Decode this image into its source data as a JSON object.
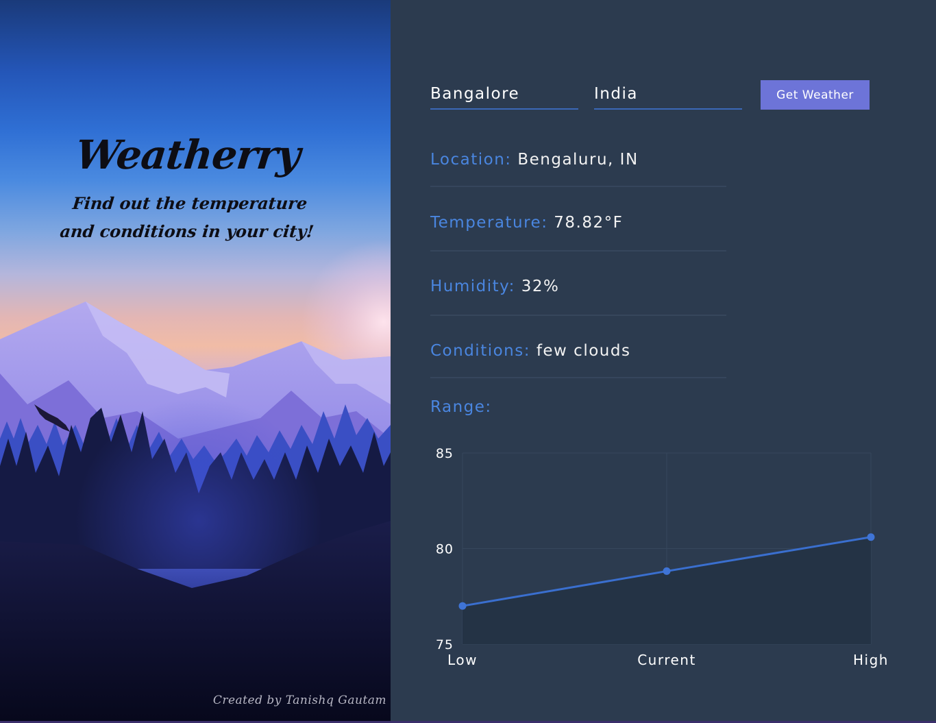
{
  "hero": {
    "title": "Weatherry",
    "subtitle_line1": "Find out the temperature",
    "subtitle_line2": "and conditions in your city!",
    "credit": "Created by Tanishq Gautam"
  },
  "form": {
    "city_value": "Bangalore",
    "country_value": "India",
    "submit_label": "Get Weather"
  },
  "info": {
    "location_label": "Location:",
    "location_value": "Bengaluru, IN",
    "temperature_label": "Temperature:",
    "temperature_value": "78.82°F",
    "humidity_label": "Humidity:",
    "humidity_value": "32%",
    "conditions_label": "Conditions:",
    "conditions_value": "few clouds",
    "range_label": "Range:"
  },
  "colors": {
    "accent": "#4a86e0",
    "button": "#6d74d8",
    "panel_bg": "#2c3b4f",
    "line": "#3a6fcf"
  },
  "chart_data": {
    "type": "line",
    "categories": [
      "Low",
      "Current",
      "High"
    ],
    "series": [
      {
        "values": [
          77.0,
          78.82,
          80.6
        ]
      }
    ],
    "ylim": [
      75,
      85
    ],
    "yticks": [
      "75",
      "80",
      "85"
    ],
    "grid": true
  }
}
